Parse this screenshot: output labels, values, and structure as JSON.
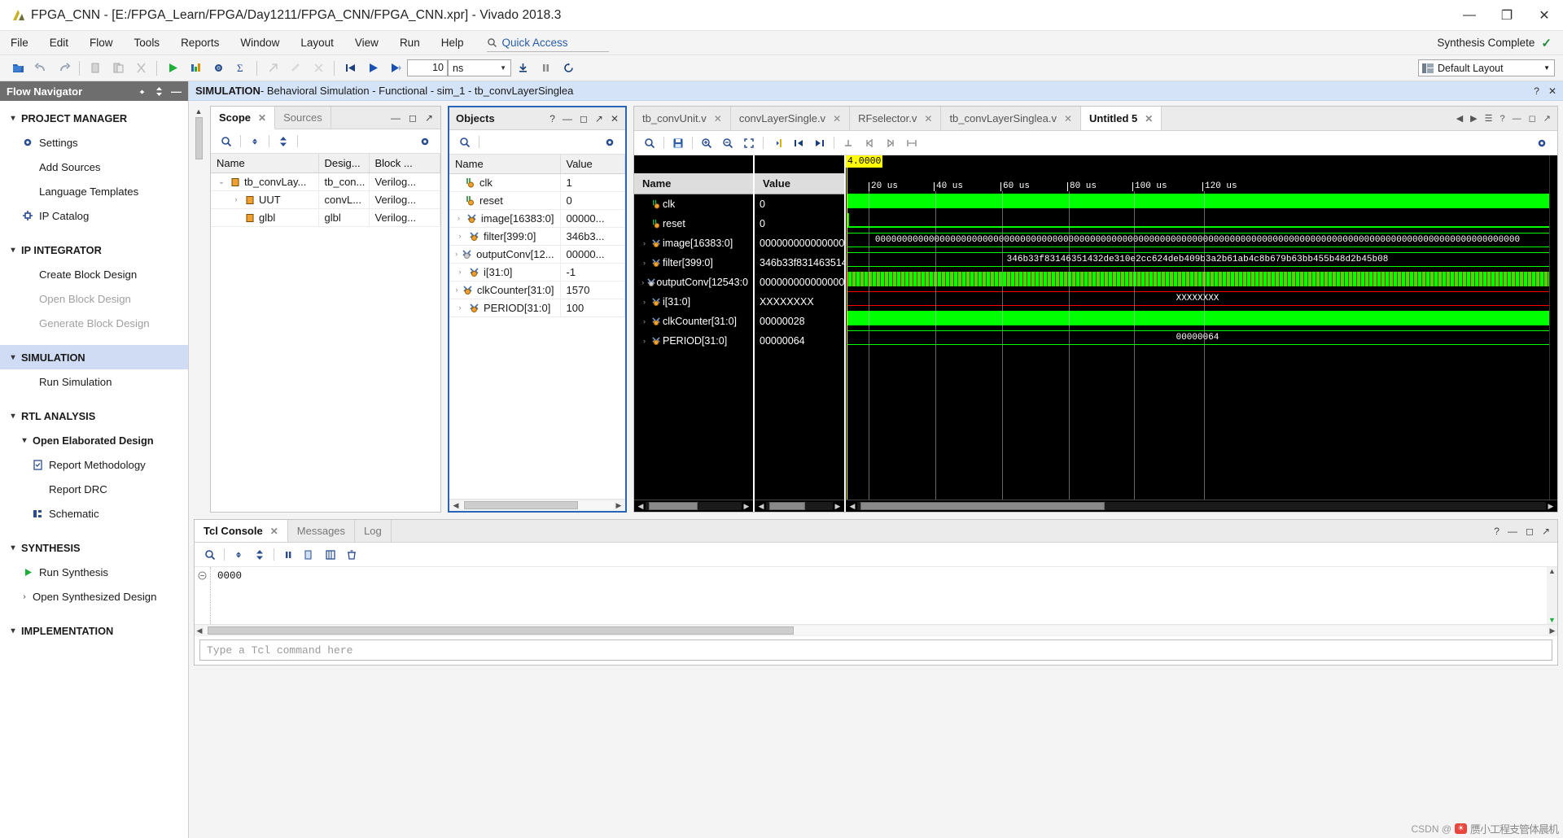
{
  "window": {
    "title": "FPGA_CNN - [E:/FPGA_Learn/FPGA/Day1211/FPGA_CNN/FPGA_CNN.xpr] - Vivado 2018.3",
    "minimize": "—",
    "maximize": "❐",
    "close": "✕"
  },
  "menu": {
    "items": [
      "File",
      "Edit",
      "Flow",
      "Tools",
      "Reports",
      "Window",
      "Layout",
      "View",
      "Run",
      "Help"
    ],
    "quick_access": "Quick Access",
    "status": "Synthesis Complete",
    "status_check": "✓"
  },
  "toolbar": {
    "time_value": "10",
    "time_unit": "ns",
    "layout": "Default Layout"
  },
  "flow_navigator": {
    "title": "Flow Navigator",
    "sections": [
      {
        "label": "PROJECT MANAGER",
        "items": [
          {
            "label": "Settings",
            "icon": "gear-icon"
          },
          {
            "label": "Add Sources",
            "icon": "none"
          },
          {
            "label": "Language Templates",
            "icon": "none"
          },
          {
            "label": "IP Catalog",
            "icon": "ip-icon"
          }
        ]
      },
      {
        "label": "IP INTEGRATOR",
        "items": [
          {
            "label": "Create Block Design",
            "icon": "none"
          },
          {
            "label": "Open Block Design",
            "icon": "none",
            "disabled": true
          },
          {
            "label": "Generate Block Design",
            "icon": "none",
            "disabled": true
          }
        ]
      },
      {
        "label": "SIMULATION",
        "selected": true,
        "items": [
          {
            "label": "Run Simulation",
            "icon": "none"
          }
        ]
      },
      {
        "label": "RTL ANALYSIS",
        "items": [
          {
            "label": "Open Elaborated Design",
            "icon": "none",
            "bold": true,
            "chevron": true
          },
          {
            "label": "Report Methodology",
            "icon": "report-icon",
            "sub": true
          },
          {
            "label": "Report DRC",
            "icon": "none",
            "sub": true
          },
          {
            "label": "Schematic",
            "icon": "schematic-icon",
            "sub": true
          }
        ]
      },
      {
        "label": "SYNTHESIS",
        "items": [
          {
            "label": "Run Synthesis",
            "icon": "run-icon"
          },
          {
            "label": "Open Synthesized Design",
            "icon": "none",
            "chevron": true
          }
        ]
      },
      {
        "label": "IMPLEMENTATION",
        "items": []
      }
    ]
  },
  "sim_bar": {
    "title": "SIMULATION",
    "subtitle": " - Behavioral Simulation - Functional - sim_1 - tb_convLayerSinglea"
  },
  "scope_panel": {
    "tabs": [
      {
        "label": "Scope",
        "active": true,
        "closable": true
      },
      {
        "label": "Sources",
        "active": false,
        "closable": false
      }
    ],
    "columns": [
      "Name",
      "Desig...",
      "Block ..."
    ],
    "rows": [
      {
        "indent": 0,
        "twisty": "⌄",
        "icon": "module-icon",
        "name": "tb_convLay...",
        "design": "tb_con...",
        "block": "Verilog..."
      },
      {
        "indent": 1,
        "twisty": "›",
        "icon": "module-icon",
        "name": "UUT",
        "design": "convL...",
        "block": "Verilog..."
      },
      {
        "indent": 1,
        "twisty": "",
        "icon": "module-icon",
        "name": "glbl",
        "design": "glbl",
        "block": "Verilog..."
      }
    ]
  },
  "objects_panel": {
    "title": "Objects",
    "columns": [
      "Name",
      "Value"
    ],
    "rows": [
      {
        "twisty": "",
        "icon": "wire-icon",
        "name": "clk",
        "value": "1"
      },
      {
        "twisty": "",
        "icon": "wire-icon",
        "name": "reset",
        "value": "0"
      },
      {
        "twisty": "›",
        "icon": "bus-icon",
        "name": "image[16383:0]",
        "value": "00000..."
      },
      {
        "twisty": "›",
        "icon": "bus-icon",
        "name": "filter[399:0]",
        "value": "346b3..."
      },
      {
        "twisty": "›",
        "icon": "bus-out-icon",
        "name": "outputConv[12...",
        "value": "00000..."
      },
      {
        "twisty": "›",
        "icon": "bus-icon",
        "name": "i[31:0]",
        "value": "-1"
      },
      {
        "twisty": "›",
        "icon": "bus-icon",
        "name": "clkCounter[31:0]",
        "value": "1570"
      },
      {
        "twisty": "›",
        "icon": "bus-icon",
        "name": "PERIOD[31:0]",
        "value": "100"
      }
    ]
  },
  "editor_tabs": [
    {
      "label": "tb_convUnit.v",
      "active": false
    },
    {
      "label": "convLayerSingle.v",
      "active": false
    },
    {
      "label": "RFselector.v",
      "active": false
    },
    {
      "label": "tb_convLayerSinglea.v",
      "active": false
    },
    {
      "label": "Untitled 5",
      "active": true
    }
  ],
  "waveform": {
    "columns": [
      "Name",
      "Value"
    ],
    "cursor_time": "4.0000",
    "time_ticks": [
      "20 us",
      "40 us",
      "60 us",
      "80 us",
      "100 us",
      "120 us"
    ],
    "rows": [
      {
        "twisty": "",
        "icon": "wire-icon",
        "name": "clk",
        "value": "0"
      },
      {
        "twisty": "",
        "icon": "wire-icon",
        "name": "reset",
        "value": "0"
      },
      {
        "twisty": "›",
        "icon": "bus-icon",
        "name": "image[16383:0]",
        "value": "00000000000000000"
      },
      {
        "twisty": "›",
        "icon": "bus-icon",
        "name": "filter[399:0]",
        "value": "346b33f8314635143"
      },
      {
        "twisty": "›",
        "icon": "bus-out-icon",
        "name": "outputConv[12543:0",
        "value": "00000000000000000"
      },
      {
        "twisty": "›",
        "icon": "bus-icon",
        "name": "i[31:0]",
        "value": "XXXXXXXX"
      },
      {
        "twisty": "›",
        "icon": "bus-icon",
        "name": "clkCounter[31:0]",
        "value": "00000028"
      },
      {
        "twisty": "›",
        "icon": "bus-icon",
        "name": "PERIOD[31:0]",
        "value": "00000064"
      }
    ],
    "wave_labels": {
      "image_bits": "000000000000000000000000000000000000000000000000000000000000000000000000000000000000000000000000000000000000000000000000",
      "filter_hex": "346b33f83146351432de310e2cc624deb409b3a2b61ab4c8b679b63bb455b48d2b45b08",
      "i_value": "XXXXXXXX",
      "period_value": "00000064"
    }
  },
  "console": {
    "tabs": [
      {
        "label": "Tcl Console",
        "active": true,
        "closable": true
      },
      {
        "label": "Messages",
        "active": false,
        "closable": false
      },
      {
        "label": "Log",
        "active": false,
        "closable": false
      }
    ],
    "output": "0000",
    "prompt_placeholder": "Type a Tcl command here"
  },
  "watermark": {
    "text": "CSDN @",
    "badge": "☀",
    "cn": "赝小工程支管体晨机"
  },
  "colors": {
    "accent": "#2a65b8",
    "selection": "#cfdcf3",
    "wave_green": "#00ff00",
    "wave_red": "#ff0000",
    "cursor_yellow": "#ffff00"
  }
}
